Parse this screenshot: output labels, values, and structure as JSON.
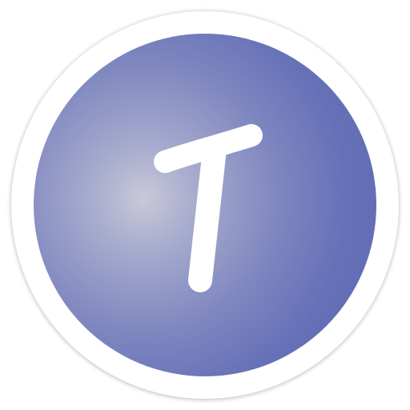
{
  "icon": {
    "name": "t-letter-app-icon",
    "ring_color": "#ffffff",
    "disc_colors": [
      "#c9c9d9",
      "#8088c0",
      "#5e69b3"
    ],
    "glyph_color": "#ffffff"
  }
}
